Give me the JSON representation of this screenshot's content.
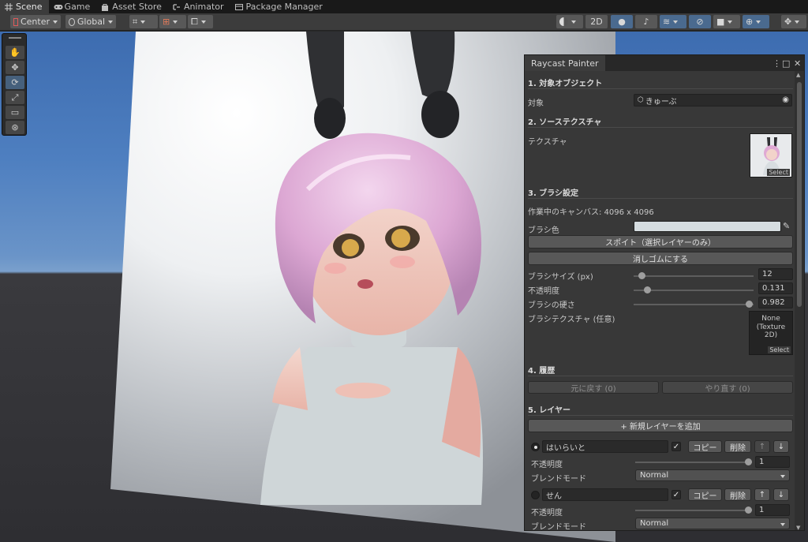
{
  "tabs": [
    {
      "label": "Scene",
      "icon": "grid-icon",
      "active": true
    },
    {
      "label": "Game",
      "icon": "gamepad-icon",
      "active": false
    },
    {
      "label": "Asset Store",
      "icon": "bag-icon",
      "active": false
    },
    {
      "label": "Animator",
      "icon": "animator-icon",
      "active": false
    },
    {
      "label": "Package Manager",
      "icon": "package-icon",
      "active": false
    }
  ],
  "toolbar": {
    "pivot": "Center",
    "space": "Global",
    "mode_2d": "2D"
  },
  "panel": {
    "title": "Raycast Painter",
    "s1": {
      "header": "1. 対象オブジェクト",
      "target_label": "対象",
      "target_value": "きゅーぶ"
    },
    "s2": {
      "header": "2. ソーステクスチャ",
      "texture_label": "テクスチャ",
      "select": "Select"
    },
    "s3": {
      "header": "3. ブラシ設定",
      "canvas_info": "作業中のキャンバス: 4096 x 4096",
      "color_label": "ブラシ色",
      "brush_color": "#d6dde0",
      "eyedrop_button": "スポイト（選択レイヤーのみ）",
      "eraser_button": "消しゴムにする",
      "size_label": "ブラシサイズ (px)",
      "size_value": "12",
      "opacity_label": "不透明度",
      "opacity_value": "0.131",
      "hardness_label": "ブラシの硬さ",
      "hardness_value": "0.982",
      "brush_tex_label": "ブラシテクスチャ (任意)",
      "brush_tex_none": "None",
      "brush_tex_type": "(Texture 2D)",
      "select": "Select"
    },
    "s4": {
      "header": "4. 履歴",
      "undo": "元に戻す (0)",
      "redo": "やり直す (0)"
    },
    "s5": {
      "header": "5. レイヤー",
      "add_button": "+ 新規レイヤーを追加",
      "layers": [
        {
          "name": "はいらいと",
          "copy": "コピー",
          "delete": "削除",
          "opacity_label": "不透明度",
          "opacity": "1",
          "blend_label": "ブレンドモード",
          "blend": "Normal",
          "selected": true
        },
        {
          "name": "せん",
          "copy": "コピー",
          "delete": "削除",
          "opacity_label": "不透明度",
          "opacity": "1",
          "blend_label": "ブレンドモード",
          "blend": "Normal",
          "selected": false
        }
      ]
    }
  }
}
